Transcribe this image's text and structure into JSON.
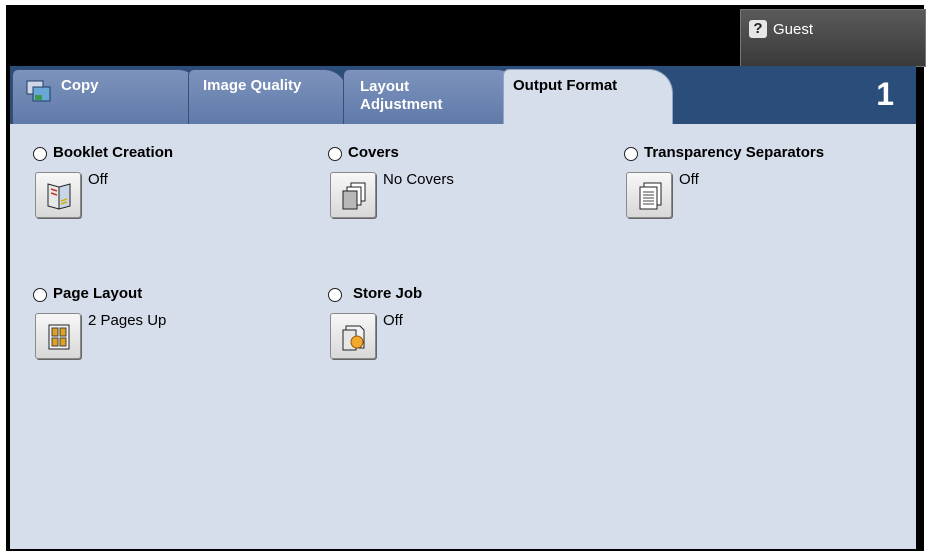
{
  "header": {
    "user_button": {
      "label": "Guest",
      "icon": "help-icon"
    }
  },
  "tabs": [
    {
      "label": "Copy",
      "icon": "copy-icon",
      "active": false
    },
    {
      "label": "Image Quality",
      "active": false
    },
    {
      "label": "Layout\nAdjustment",
      "active": false
    },
    {
      "label": "Output Format",
      "active": true
    }
  ],
  "tab_number": "1",
  "options": {
    "booklet_creation": {
      "title": "Booklet Creation",
      "value": "Off",
      "icon": "booklet-icon"
    },
    "covers": {
      "title": "Covers",
      "value": "No Covers",
      "icon": "covers-icon"
    },
    "transparency_separators": {
      "title": "Transparency Separators",
      "value": "Off",
      "icon": "transparency-icon"
    },
    "page_layout": {
      "title": "Page Layout",
      "value": "2 Pages Up",
      "icon": "page-layout-icon"
    },
    "store_job": {
      "title": "Store Job",
      "value": "Off",
      "icon": "store-job-icon"
    }
  },
  "colors": {
    "tab_bar": "#2a4d7a",
    "tab_inactive": "#6f86b3",
    "content_bg": "#d6deeb"
  }
}
